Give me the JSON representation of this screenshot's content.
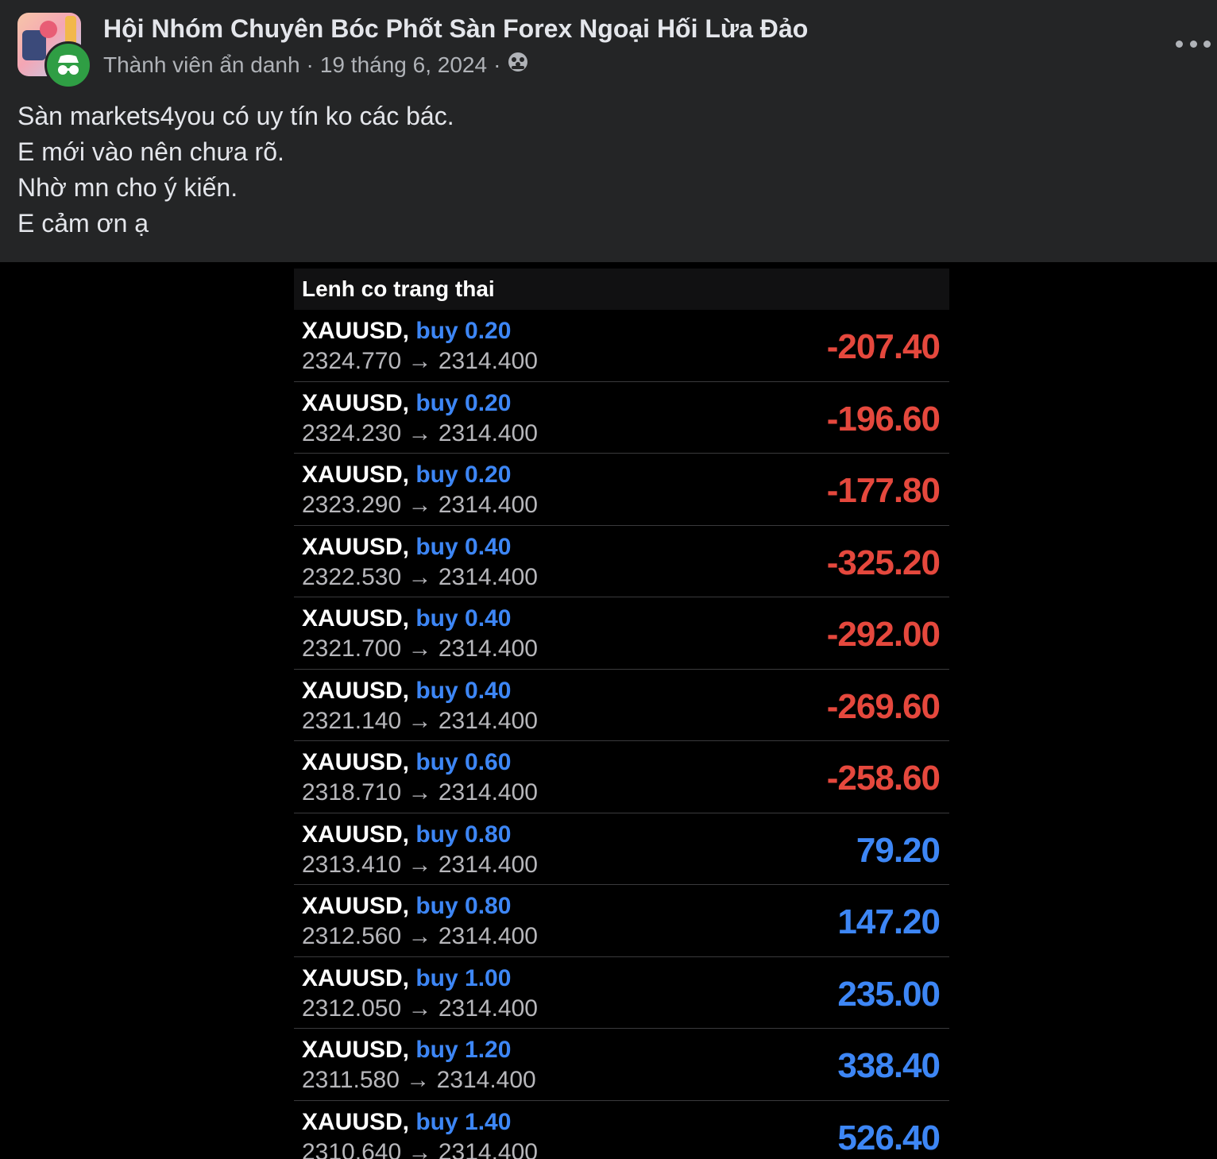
{
  "post": {
    "group_name": "Hội Nhóm Chuyên Bóc Phốt Sàn Forex Ngoại Hối Lừa Đảo",
    "author": "Thành viên ẩn danh",
    "date": "19 tháng 6, 2024",
    "separator": "·",
    "privacy_icon": "group-privacy-icon",
    "text_lines": [
      "Sàn markets4you có uy tín ko các bác.",
      "E mới vào nên chưa rõ.",
      "Nhờ mn cho ý kiến.",
      "E cảm ơn ạ"
    ]
  },
  "trades": {
    "header": "Lenh co trang thai",
    "arrow": "→",
    "rows": [
      {
        "symbol": "XAUUSD,",
        "side": "buy 0.20",
        "open": "2324.770",
        "current": "2314.400",
        "pnl": "-207.40",
        "sign": "neg"
      },
      {
        "symbol": "XAUUSD,",
        "side": "buy 0.20",
        "open": "2324.230",
        "current": "2314.400",
        "pnl": "-196.60",
        "sign": "neg"
      },
      {
        "symbol": "XAUUSD,",
        "side": "buy 0.20",
        "open": "2323.290",
        "current": "2314.400",
        "pnl": "-177.80",
        "sign": "neg"
      },
      {
        "symbol": "XAUUSD,",
        "side": "buy 0.40",
        "open": "2322.530",
        "current": "2314.400",
        "pnl": "-325.20",
        "sign": "neg"
      },
      {
        "symbol": "XAUUSD,",
        "side": "buy 0.40",
        "open": "2321.700",
        "current": "2314.400",
        "pnl": "-292.00",
        "sign": "neg"
      },
      {
        "symbol": "XAUUSD,",
        "side": "buy 0.40",
        "open": "2321.140",
        "current": "2314.400",
        "pnl": "-269.60",
        "sign": "neg"
      },
      {
        "symbol": "XAUUSD,",
        "side": "buy 0.60",
        "open": "2318.710",
        "current": "2314.400",
        "pnl": "-258.60",
        "sign": "neg"
      },
      {
        "symbol": "XAUUSD,",
        "side": "buy 0.80",
        "open": "2313.410",
        "current": "2314.400",
        "pnl": "79.20",
        "sign": "pos"
      },
      {
        "symbol": "XAUUSD,",
        "side": "buy 0.80",
        "open": "2312.560",
        "current": "2314.400",
        "pnl": "147.20",
        "sign": "pos"
      },
      {
        "symbol": "XAUUSD,",
        "side": "buy 1.00",
        "open": "2312.050",
        "current": "2314.400",
        "pnl": "235.00",
        "sign": "pos"
      },
      {
        "symbol": "XAUUSD,",
        "side": "buy 1.20",
        "open": "2311.580",
        "current": "2314.400",
        "pnl": "338.40",
        "sign": "pos"
      },
      {
        "symbol": "XAUUSD,",
        "side": "buy 1.40",
        "open": "2310.640",
        "current": "2314.400",
        "pnl": "526.40",
        "sign": "pos"
      }
    ]
  },
  "colors": {
    "background": "#242526",
    "negative": "#e5483d",
    "positive": "#3d86f5",
    "anon_badge": "#2f9e44"
  }
}
